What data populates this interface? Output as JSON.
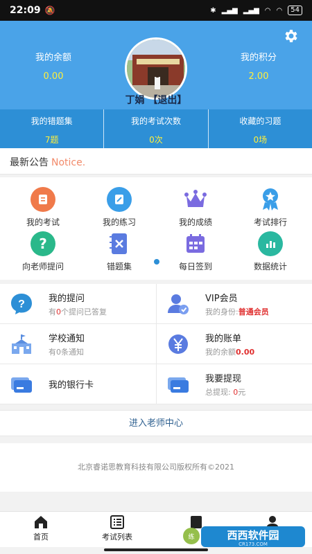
{
  "status_bar": {
    "time": "22:09",
    "battery": "54"
  },
  "header": {
    "balance_label": "我的余额",
    "balance_value": "0.00",
    "points_label": "我的积分",
    "points_value": "2.00",
    "user_name": "丁娟",
    "logout_label": "【退出】"
  },
  "stats": [
    {
      "label": "我的错题集",
      "value": "7题"
    },
    {
      "label": "我的考试次数",
      "value": "0次"
    },
    {
      "label": "收藏的习题",
      "value": "0场"
    }
  ],
  "notice": {
    "title": "最新公告",
    "subtitle": "Notice."
  },
  "grid": [
    {
      "label": "我的考试",
      "icon": "exam-icon",
      "color": "#f07a4a"
    },
    {
      "label": "我的练习",
      "icon": "practice-icon",
      "color": "#3a9ee8"
    },
    {
      "label": "我的成绩",
      "icon": "crown-icon",
      "color": "#7a6be0"
    },
    {
      "label": "考试排行",
      "icon": "ranking-badge-icon",
      "color": "#3a9ee8"
    },
    {
      "label": "向老师提问",
      "icon": "question-icon",
      "color": "#2ab88a"
    },
    {
      "label": "错题集",
      "icon": "wrong-book-icon",
      "color": "#5a7be0"
    },
    {
      "label": "每日签到",
      "icon": "calendar-icon",
      "color": "#7a6be0"
    },
    {
      "label": "数据统计",
      "icon": "statistics-icon",
      "color": "#2ab8a0"
    }
  ],
  "cards": {
    "questions": {
      "title": "我的提问",
      "sub_prefix": "有",
      "count": "0",
      "sub_suffix": "个提问已答复"
    },
    "vip": {
      "title": "VIP会员",
      "sub_prefix": "我的身份:",
      "level": "普通会员"
    },
    "school": {
      "title": "学校通知",
      "sub_prefix": "有",
      "count": "0",
      "sub_suffix": "条通知"
    },
    "bill": {
      "title": "我的账单",
      "sub_prefix": "我的余额",
      "amount": "0.00"
    },
    "bank": {
      "title": "我的银行卡"
    },
    "withdraw": {
      "title": "我要提现",
      "sub_prefix": "总提现:",
      "amount": "0",
      "sub_suffix": "元"
    }
  },
  "teacher_center": "进入老师中心",
  "copyright": "北京睿诺思教育科技有限公司版权所有©2021",
  "tabbar": [
    {
      "label": "首页",
      "icon": "home-icon"
    },
    {
      "label": "考试列表",
      "icon": "list-icon"
    }
  ],
  "watermark": {
    "brand": "西西软件园",
    "domain": "CR173.COM"
  },
  "colors": {
    "header": "#4aa3e8",
    "stats_bar": "#2d8fd6",
    "highlight": "#ffef3b",
    "red": "#e03030"
  }
}
